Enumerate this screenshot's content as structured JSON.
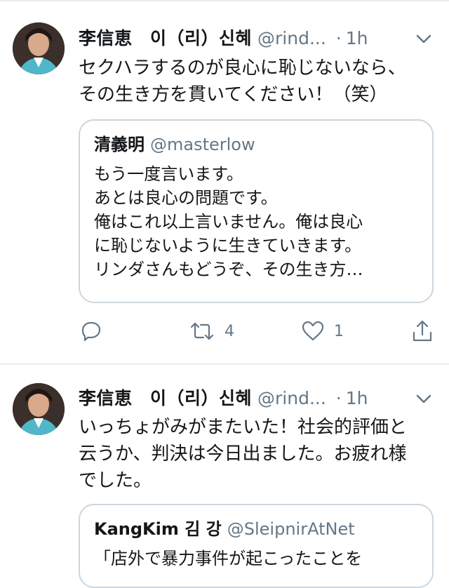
{
  "tweets": [
    {
      "author_name": "李信恵　이（리）신혜",
      "handle": "@rind...",
      "time": "1h",
      "text_lines": [
        "セクハラするのが良心に恥じないなら、",
        "その生き方を貫いてください！（笑）"
      ],
      "quote": {
        "author_name": "清義明",
        "handle": "@masterlow",
        "text_lines": [
          "もう一度言います。",
          "あとは良心の問題です。",
          "俺はこれ以上言いません。俺は良心",
          "に恥じないように生きていきます。",
          "リンダさんもどうぞ、その生き方…"
        ]
      },
      "actions": {
        "retweets": "4",
        "likes": "1"
      }
    },
    {
      "author_name": "李信恵　이（리）신혜",
      "handle": "@rind...",
      "time": "1h",
      "text_lines": [
        "いっちょがみがまたいた！社会的評価と",
        "云うか、判決は今日出ました。お疲れ様",
        "でした。"
      ],
      "quote": {
        "author_name": "KangKim 김 강",
        "handle": "@SleipnirAtNet",
        "text_lines": [
          "「店外で暴力事件が起こったことを"
        ]
      }
    }
  ],
  "icons": {
    "reply": "reply-icon",
    "retweet": "retweet-icon",
    "like": "heart-icon",
    "share": "share-icon",
    "more": "chevron-down-icon"
  },
  "colors": {
    "text": "#14171a",
    "secondary": "#657786",
    "border": "#ccd6dd",
    "divider": "#e6ecf0"
  }
}
